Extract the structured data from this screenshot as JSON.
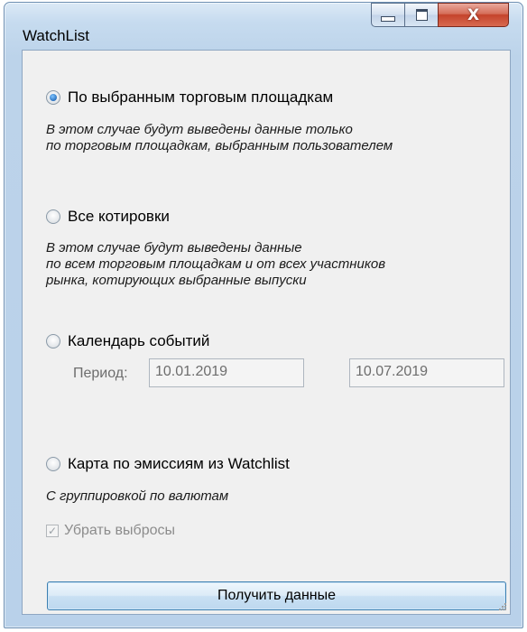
{
  "window": {
    "title": "WatchList",
    "close_symbol": "X"
  },
  "options": {
    "selected_venues": {
      "label": "По выбранным торговым площадкам",
      "desc_line1": "В этом случае будут выведены данные только",
      "desc_line2": "по торговым площадкам, выбранным пользователем",
      "checked": true
    },
    "all_quotes": {
      "label": "Все котировки",
      "desc_line1": "В этом случае будут выведены данные",
      "desc_line2": "по всем торговым площадкам и от всех участников",
      "desc_line3": "рынка, котирующих выбранные выпуски",
      "checked": false
    },
    "events_calendar": {
      "label": "Календарь событий",
      "period_label": "Период:",
      "date_from": "10.01.2019",
      "date_to": "10.07.2019",
      "checked": false
    },
    "emission_map": {
      "label": "Карта по эмиссиям из Watchlist",
      "desc_line1": "С группировкой по валютам",
      "remove_outliers_label": "Убрать выбросы",
      "remove_outliers_checked": true,
      "checked": false
    }
  },
  "submit_button": {
    "label": "Получить данные"
  }
}
